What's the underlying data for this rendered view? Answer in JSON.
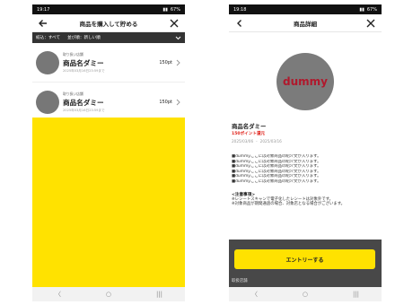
{
  "screen1": {
    "status": {
      "time": "19:17",
      "battery": "67%"
    },
    "title": "商品を購入して貯める",
    "filter": {
      "narrow": "絞込：すべて",
      "sort": "並び順：新しい順"
    },
    "items": [
      {
        "store": "取り扱い店舗",
        "name": "商品名ダミー",
        "date": "2025年03月16日23:59まで",
        "points": "150pt"
      },
      {
        "store": "取り扱い店舗",
        "name": "商品名ダミー",
        "date": "2025年03月16日23:59まで",
        "points": "150pt"
      }
    ],
    "nav": {
      "back": "〈",
      "home": "○",
      "recent": "|||"
    },
    "colors": {
      "accent": "#ffe200"
    }
  },
  "screen2": {
    "status": {
      "time": "19:18",
      "battery": "67%"
    },
    "title": "商品詳細",
    "image_text": "dummy",
    "name": "商品名ダミー",
    "points": "150ポイント還元",
    "period_start": "2025/03/06",
    "period_sep": "-",
    "period_end": "2025/03/16",
    "description": [
      "■dummyここには対象商品の紹介文が入ります。",
      "■dummyここには対象商品の紹介文が入ります。",
      "■dummyここには対象商品の紹介文が入ります。",
      "■dummyここには対象商品の紹介文が入ります。",
      "■dummyここには対象商品の紹介文が入ります。",
      "■dummyここには対象商品の紹介文が入ります。"
    ],
    "notes_heading": "<注意事項>",
    "notes": [
      "※レシートスキャンで電子化したレシートは対象外です。",
      "※対象商品が期間通過の場合、対象店となる場合がございます。"
    ],
    "entry_button": "エントリーする",
    "below_label": "取扱店舗",
    "nav": {
      "back": "〈",
      "home": "○",
      "recent": "|||"
    }
  }
}
